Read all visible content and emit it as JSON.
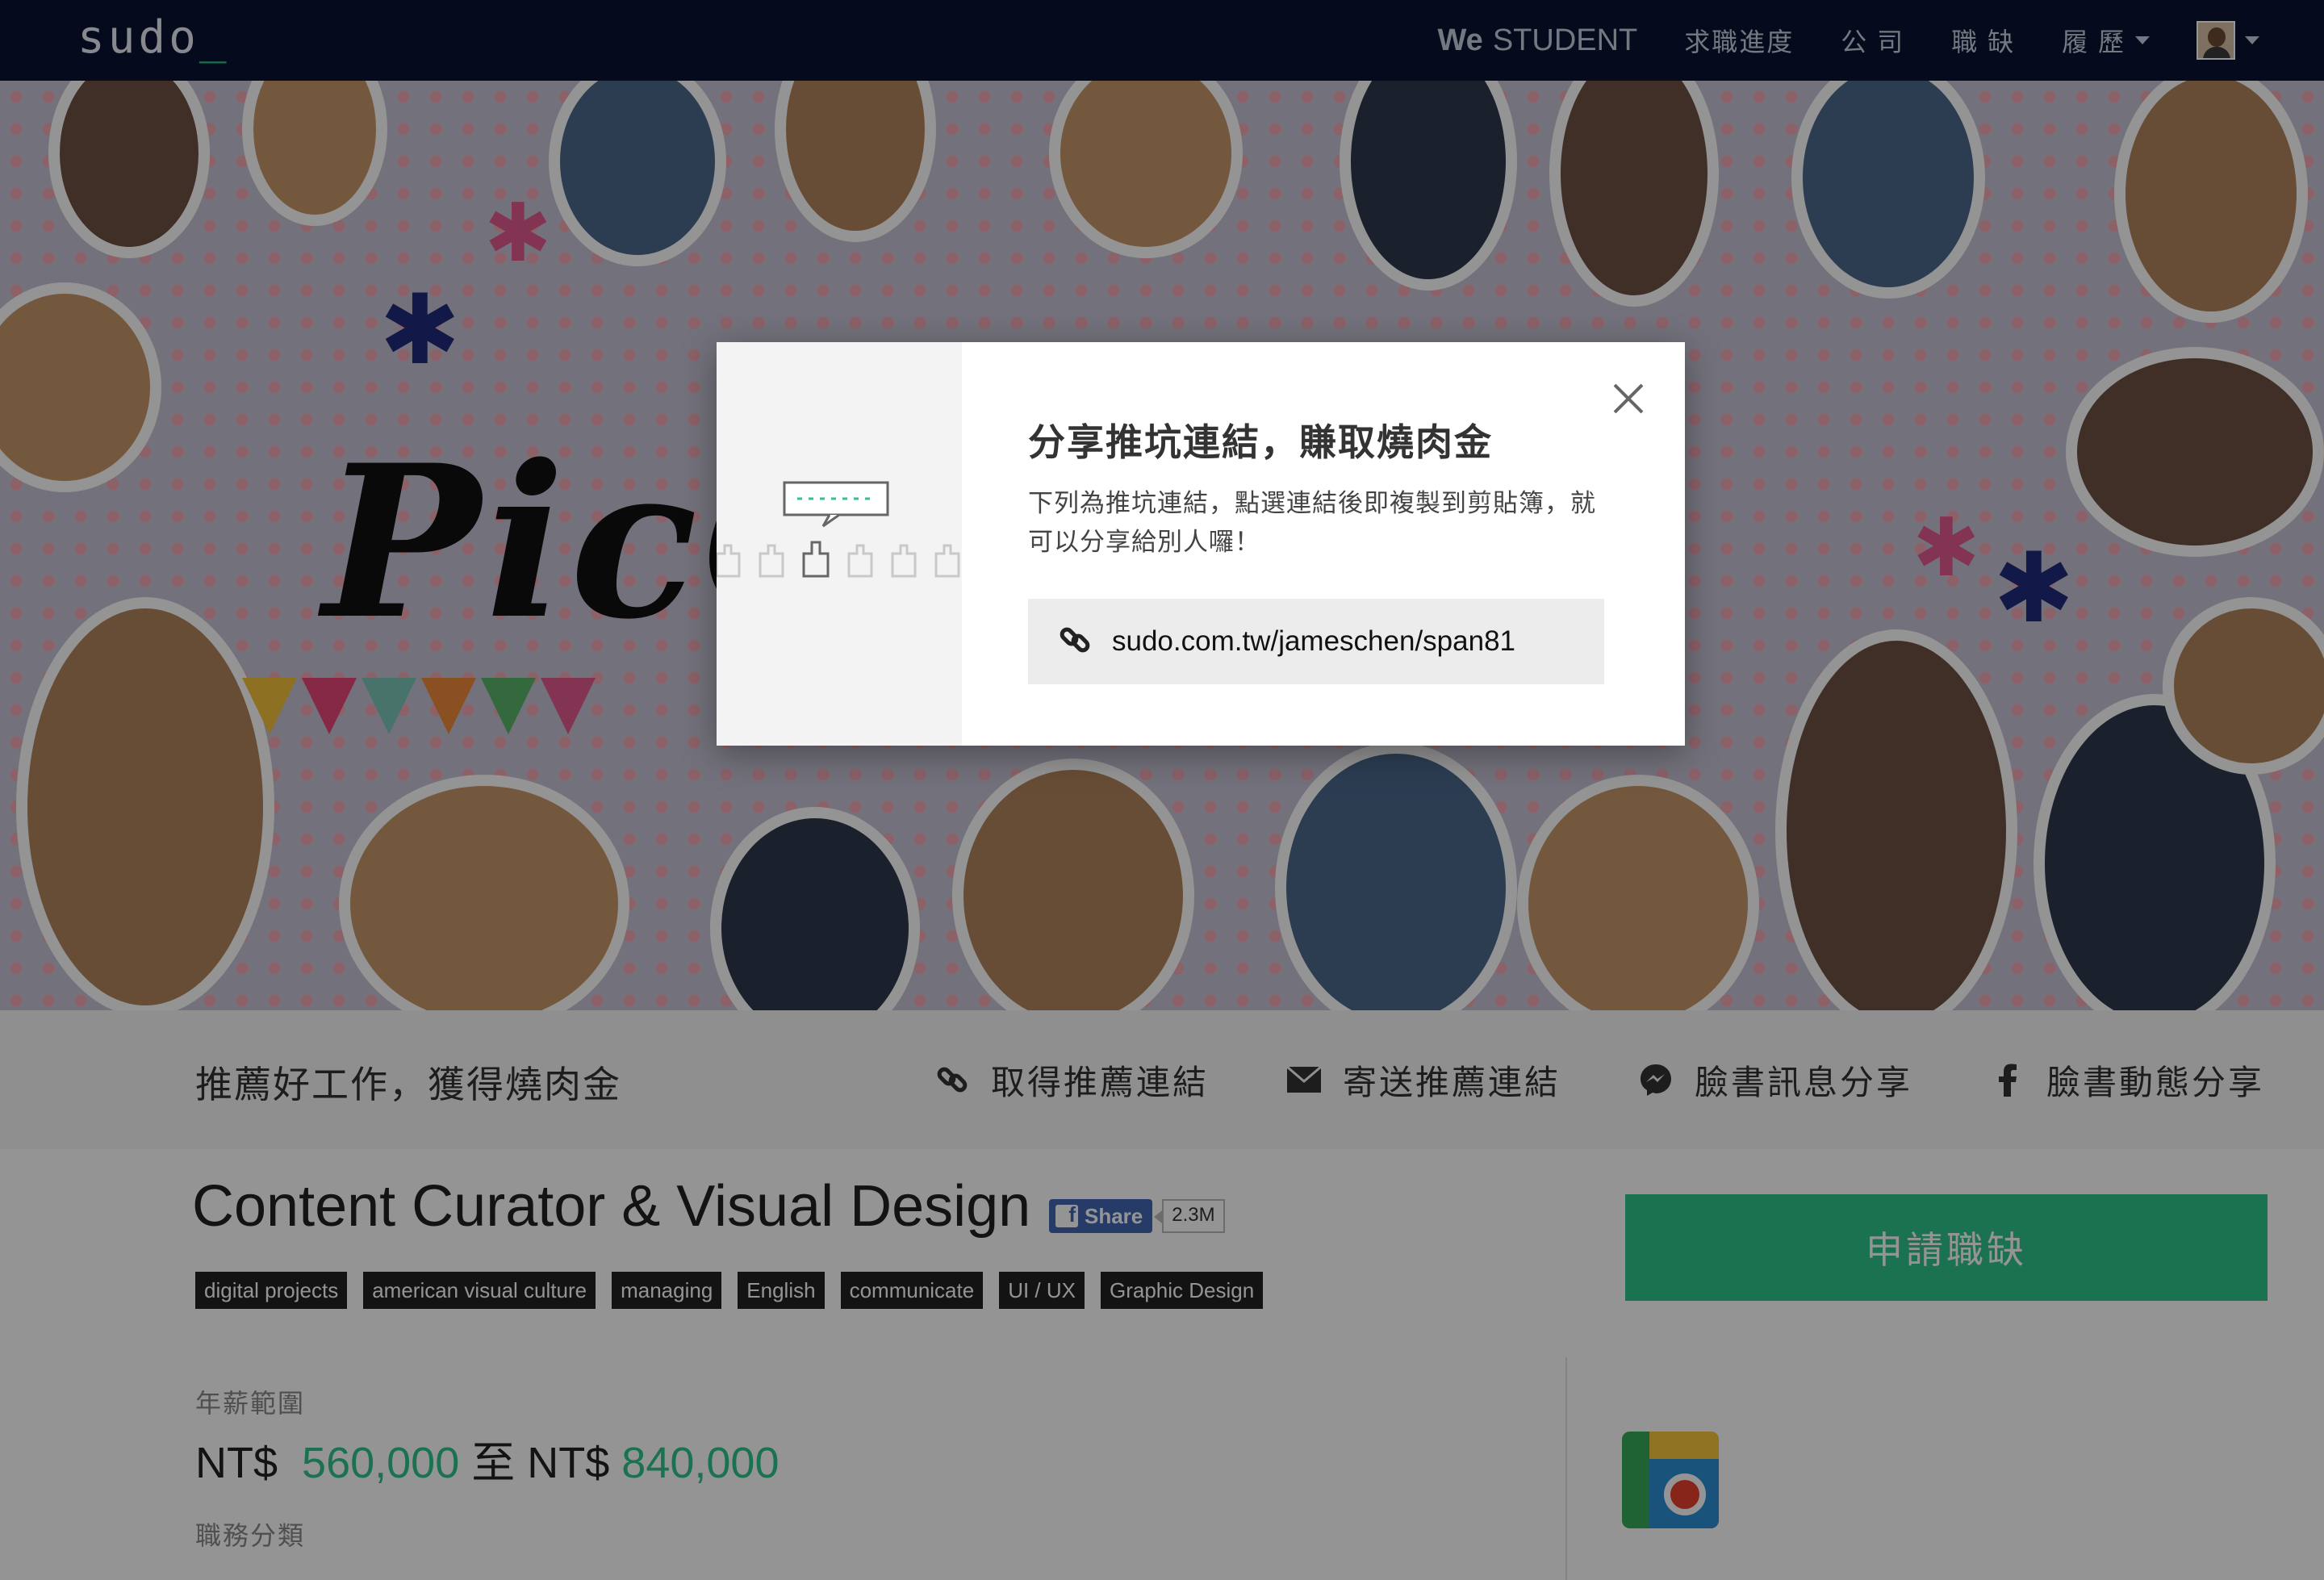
{
  "nav": {
    "logo": "sudo",
    "logo_cursor": "_",
    "brand_bold": "We",
    "brand_thin": "STUDENT",
    "items": [
      "求職進度",
      "公 司",
      "職 缺",
      "履 歷"
    ]
  },
  "share_bar": {
    "title": "推薦好工作，獲得燒肉金",
    "actions": [
      {
        "icon": "link-icon",
        "label": "取得推薦連結"
      },
      {
        "icon": "envelope-icon",
        "label": "寄送推薦連結"
      },
      {
        "icon": "messenger-icon",
        "label": "臉書訊息分享"
      },
      {
        "icon": "facebook-icon",
        "label": "臉書動態分享"
      }
    ]
  },
  "job": {
    "title": "Content Curator & Visual Design",
    "fb_share_label": "Share",
    "fb_share_count": "2.3M",
    "tags": [
      "digital projects",
      "american visual culture",
      "managing",
      "English",
      "communicate",
      "UI / UX",
      "Graphic Design"
    ],
    "apply_label": "申請職缺",
    "salary_label": "年薪範圍",
    "salary_currency_min": "NT$",
    "salary_min": "560,000",
    "salary_to": "至",
    "salary_currency_max": "NT$",
    "salary_max": "840,000",
    "category_label": "職務分類"
  },
  "modal": {
    "title": "分享推坑連結，賺取燒肉金",
    "description": "下列為推坑連結，點選連結後即複製到剪貼簿，就可以分享給別人囉！",
    "link": "sudo.com.tw/jameschen/span81"
  },
  "colors": {
    "nav_bg": "#0a1433",
    "accent_green": "#2dc58a",
    "facebook_blue": "#4267b2"
  }
}
